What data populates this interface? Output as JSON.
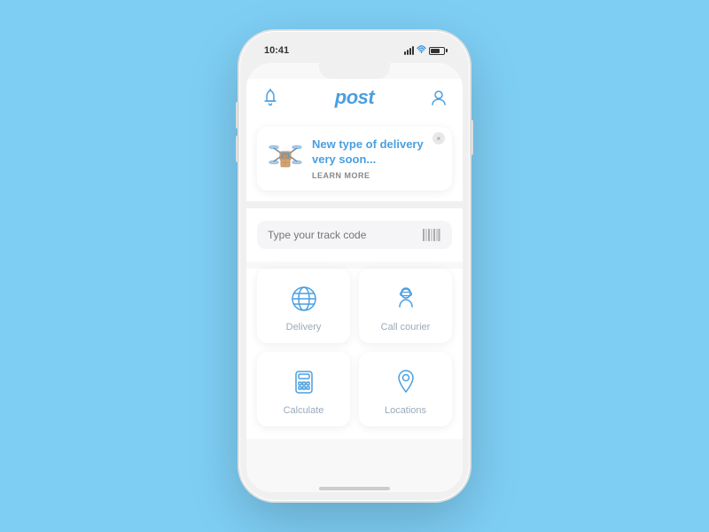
{
  "status_bar": {
    "time": "10:41"
  },
  "header": {
    "title": "post",
    "bell_icon": "bell-icon",
    "profile_icon": "profile-icon"
  },
  "banner": {
    "title": "New type of delivery very soon...",
    "learn_more": "LEARN MORE",
    "emoji": "📦",
    "close_label": "×"
  },
  "track": {
    "placeholder": "Type your track code"
  },
  "grid": {
    "items": [
      {
        "label": "Delivery",
        "icon": "globe-icon"
      },
      {
        "label": "Call courier",
        "icon": "courier-icon"
      },
      {
        "label": "Calculate",
        "icon": "calculator-icon"
      },
      {
        "label": "Locations",
        "icon": "location-icon"
      }
    ]
  },
  "colors": {
    "accent": "#4a9fe0",
    "background": "#7ecef4"
  }
}
